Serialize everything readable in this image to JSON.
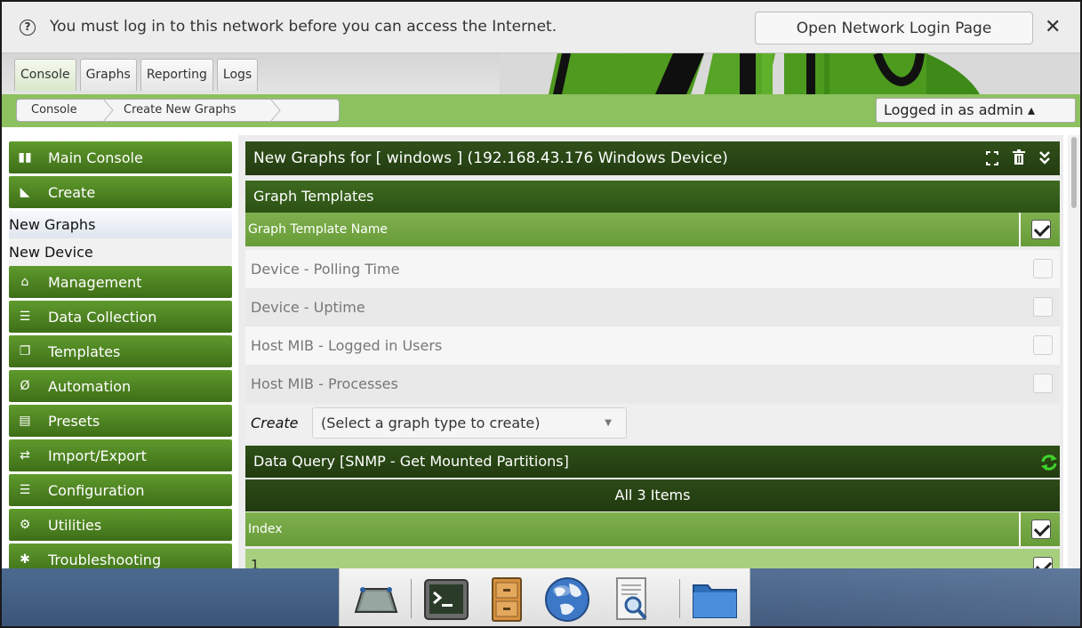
{
  "notification": {
    "message": "You must log in to this network before you can access the Internet.",
    "button_label": "Open Network Login Page",
    "close_glyph": "✕",
    "help_glyph": "?"
  },
  "tabs": [
    {
      "label": "Console",
      "active": true
    },
    {
      "label": "Graphs",
      "active": false
    },
    {
      "label": "Reporting",
      "active": false
    },
    {
      "label": "Logs",
      "active": false
    }
  ],
  "breadcrumb": [
    "Console",
    "Create New Graphs"
  ],
  "user": {
    "label": "Logged in as admin ▴"
  },
  "sidebar": {
    "items": [
      {
        "label": "Main Console",
        "icon": "map-icon",
        "glyph": "▮▮"
      },
      {
        "label": "Create",
        "icon": "chart-area-icon",
        "glyph": "◣"
      },
      {
        "label": "Management",
        "icon": "home-icon",
        "glyph": "⌂"
      },
      {
        "label": "Data Collection",
        "icon": "database-icon",
        "glyph": "☰"
      },
      {
        "label": "Templates",
        "icon": "clone-icon",
        "glyph": "❐"
      },
      {
        "label": "Automation",
        "icon": "empty-set-icon",
        "glyph": "Ø"
      },
      {
        "label": "Presets",
        "icon": "archive-icon",
        "glyph": "▤"
      },
      {
        "label": "Import/Export",
        "icon": "exchange-icon",
        "glyph": "⇄"
      },
      {
        "label": "Configuration",
        "icon": "sliders-icon",
        "glyph": "☰"
      },
      {
        "label": "Utilities",
        "icon": "cogs-icon",
        "glyph": "⚙"
      },
      {
        "label": "Troubleshooting",
        "icon": "bug-icon",
        "glyph": "✱"
      }
    ],
    "create_subitems": [
      {
        "label": "New Graphs",
        "selected": true
      },
      {
        "label": "New Device",
        "selected": false
      }
    ]
  },
  "main": {
    "title": "New Graphs for [ windows ] (192.168.43.176 Windows Device)",
    "graph_templates": {
      "heading": "Graph Templates",
      "column": "Graph Template Name",
      "rows": [
        "Device - Polling Time",
        "Device - Uptime",
        "Host MIB - Logged in Users",
        "Host MIB - Processes"
      ],
      "create_label": "Create",
      "create_select": "(Select a graph type to create)"
    },
    "data_query": {
      "heading": "Data Query [SNMP - Get Mounted Partitions]",
      "items_label": "All 3 Items",
      "column": "Index",
      "first_row": "1"
    }
  },
  "colors": {
    "nav_green": "#4a7f21",
    "header_dark": "#263f13",
    "breadcrumb_green": "#8dc05f",
    "row_green": "#a7d07e",
    "taskbar": "#46618a"
  }
}
